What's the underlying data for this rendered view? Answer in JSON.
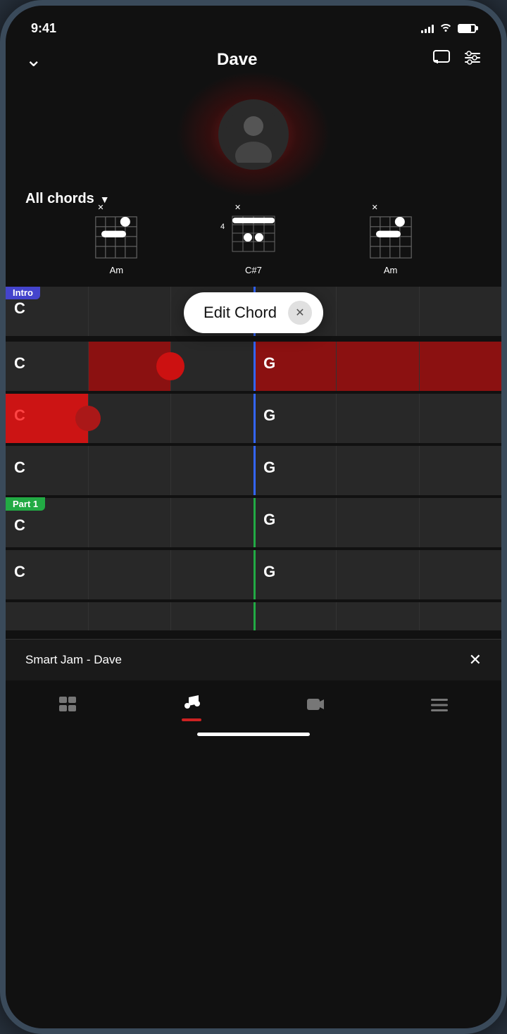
{
  "status": {
    "time": "9:41",
    "signal_bars": [
      4,
      6,
      8,
      10,
      12
    ],
    "battery_percent": 75
  },
  "header": {
    "title": "Dave",
    "back_label": "chevron down",
    "message_icon": "message-icon",
    "settings_icon": "settings-icon"
  },
  "all_chords": {
    "label": "All chords",
    "dropdown": true
  },
  "chord_diagrams": [
    {
      "name": "Am",
      "fret": null,
      "x_mark": true,
      "x_pos": "left"
    },
    {
      "name": "C#7",
      "fret": "4",
      "x_mark": true,
      "x_pos": "left"
    },
    {
      "name": "Am",
      "fret": null,
      "x_mark": true,
      "x_pos": "left"
    }
  ],
  "edit_chord_popup": {
    "label": "Edit Chord",
    "close_button": "✕"
  },
  "chord_rows": [
    {
      "id": "row1",
      "badge": "Intro",
      "badge_type": "intro",
      "left_chord": "C",
      "right_chord": "",
      "divider": "blue",
      "row_type": "intro"
    },
    {
      "id": "row2",
      "badge": null,
      "left_chord": "C",
      "right_chord": "G",
      "divider": "blue",
      "row_type": "red-active"
    },
    {
      "id": "row3",
      "badge": null,
      "left_chord": "C",
      "right_chord": "G",
      "divider": "blue",
      "row_type": "red-partial"
    },
    {
      "id": "row4",
      "badge": null,
      "left_chord": "C",
      "right_chord": "G",
      "divider": "blue",
      "row_type": "normal"
    },
    {
      "id": "row5",
      "badge": "Part 1",
      "badge_type": "part1",
      "left_chord": "C",
      "right_chord": "G",
      "divider": "green",
      "row_type": "part1"
    },
    {
      "id": "row6",
      "badge": null,
      "left_chord": "C",
      "right_chord": "G",
      "divider": "green",
      "row_type": "normal-green"
    }
  ],
  "player": {
    "title": "Smart Jam - Dave",
    "close_icon": "✕"
  },
  "bottom_nav": {
    "items": [
      {
        "id": "grid",
        "icon": "⊞",
        "label": "grid",
        "active": false
      },
      {
        "id": "music",
        "icon": "♪",
        "label": "music",
        "active": true
      },
      {
        "id": "video",
        "icon": "▶",
        "label": "video",
        "active": false
      },
      {
        "id": "menu",
        "icon": "≡",
        "label": "menu",
        "active": false
      }
    ]
  }
}
